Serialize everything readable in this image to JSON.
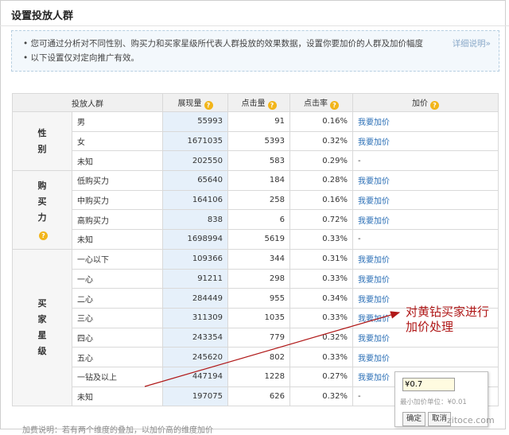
{
  "page_title": "设置投放人群",
  "notice": {
    "line1": "您可通过分析对不同性别、购买力和买家星级所代表人群投放的效果数据，设置你要加价的人群及加价幅度",
    "line2": "以下设置仅对定向推广有效。",
    "detail_link": "详细说明»"
  },
  "table": {
    "headers": [
      "投放人群",
      "展现量",
      "点击量",
      "点击率",
      "加价"
    ],
    "groups": [
      {
        "label": "性别",
        "has_help": false,
        "rows": [
          {
            "name": "男",
            "impressions": "55993",
            "clicks": "91",
            "ctr": "0.16%",
            "action": "我要加价"
          },
          {
            "name": "女",
            "impressions": "1671035",
            "clicks": "5393",
            "ctr": "0.32%",
            "action": "我要加价"
          },
          {
            "name": "未知",
            "impressions": "202550",
            "clicks": "583",
            "ctr": "0.29%",
            "action": "-"
          }
        ]
      },
      {
        "label": "购买力",
        "has_help": true,
        "rows": [
          {
            "name": "低购买力",
            "impressions": "65640",
            "clicks": "184",
            "ctr": "0.28%",
            "action": "我要加价"
          },
          {
            "name": "中购买力",
            "impressions": "164106",
            "clicks": "258",
            "ctr": "0.16%",
            "action": "我要加价"
          },
          {
            "name": "高购买力",
            "impressions": "838",
            "clicks": "6",
            "ctr": "0.72%",
            "action": "我要加价"
          },
          {
            "name": "未知",
            "impressions": "1698994",
            "clicks": "5619",
            "ctr": "0.33%",
            "action": "-"
          }
        ]
      },
      {
        "label": "买家星级",
        "has_help": false,
        "rows": [
          {
            "name": "一心以下",
            "impressions": "109366",
            "clicks": "344",
            "ctr": "0.31%",
            "action": "我要加价"
          },
          {
            "name": "一心",
            "impressions": "91211",
            "clicks": "298",
            "ctr": "0.33%",
            "action": "我要加价"
          },
          {
            "name": "二心",
            "impressions": "284449",
            "clicks": "955",
            "ctr": "0.34%",
            "action": "我要加价"
          },
          {
            "name": "三心",
            "impressions": "311309",
            "clicks": "1035",
            "ctr": "0.33%",
            "action": "我要加价"
          },
          {
            "name": "四心",
            "impressions": "243354",
            "clicks": "779",
            "ctr": "0.32%",
            "action": "我要加价"
          },
          {
            "name": "五心",
            "impressions": "245620",
            "clicks": "802",
            "ctr": "0.33%",
            "action": "我要加价"
          },
          {
            "name": "一钻及以上",
            "impressions": "447194",
            "clicks": "1228",
            "ctr": "0.27%",
            "action": "我要加价"
          },
          {
            "name": "未知",
            "impressions": "197075",
            "clicks": "626",
            "ctr": "0.32%",
            "action": "-"
          }
        ]
      }
    ]
  },
  "popup": {
    "value": "¥0.7",
    "min_unit": "最小加价单位：¥0.01",
    "confirm": "确定",
    "cancel": "取消"
  },
  "annotation": {
    "line1": "对黄钻买家进行",
    "line2": "加价处理"
  },
  "footer_text": "加费说明：若有两个维度的叠加，以加价高的维度加价",
  "watermark": "zitoce.com",
  "colors": {
    "link": "#2b6fb6",
    "help_icon": "#f2b51a",
    "annotation": "#b01818",
    "highlight_col": "#e6f0fa"
  }
}
